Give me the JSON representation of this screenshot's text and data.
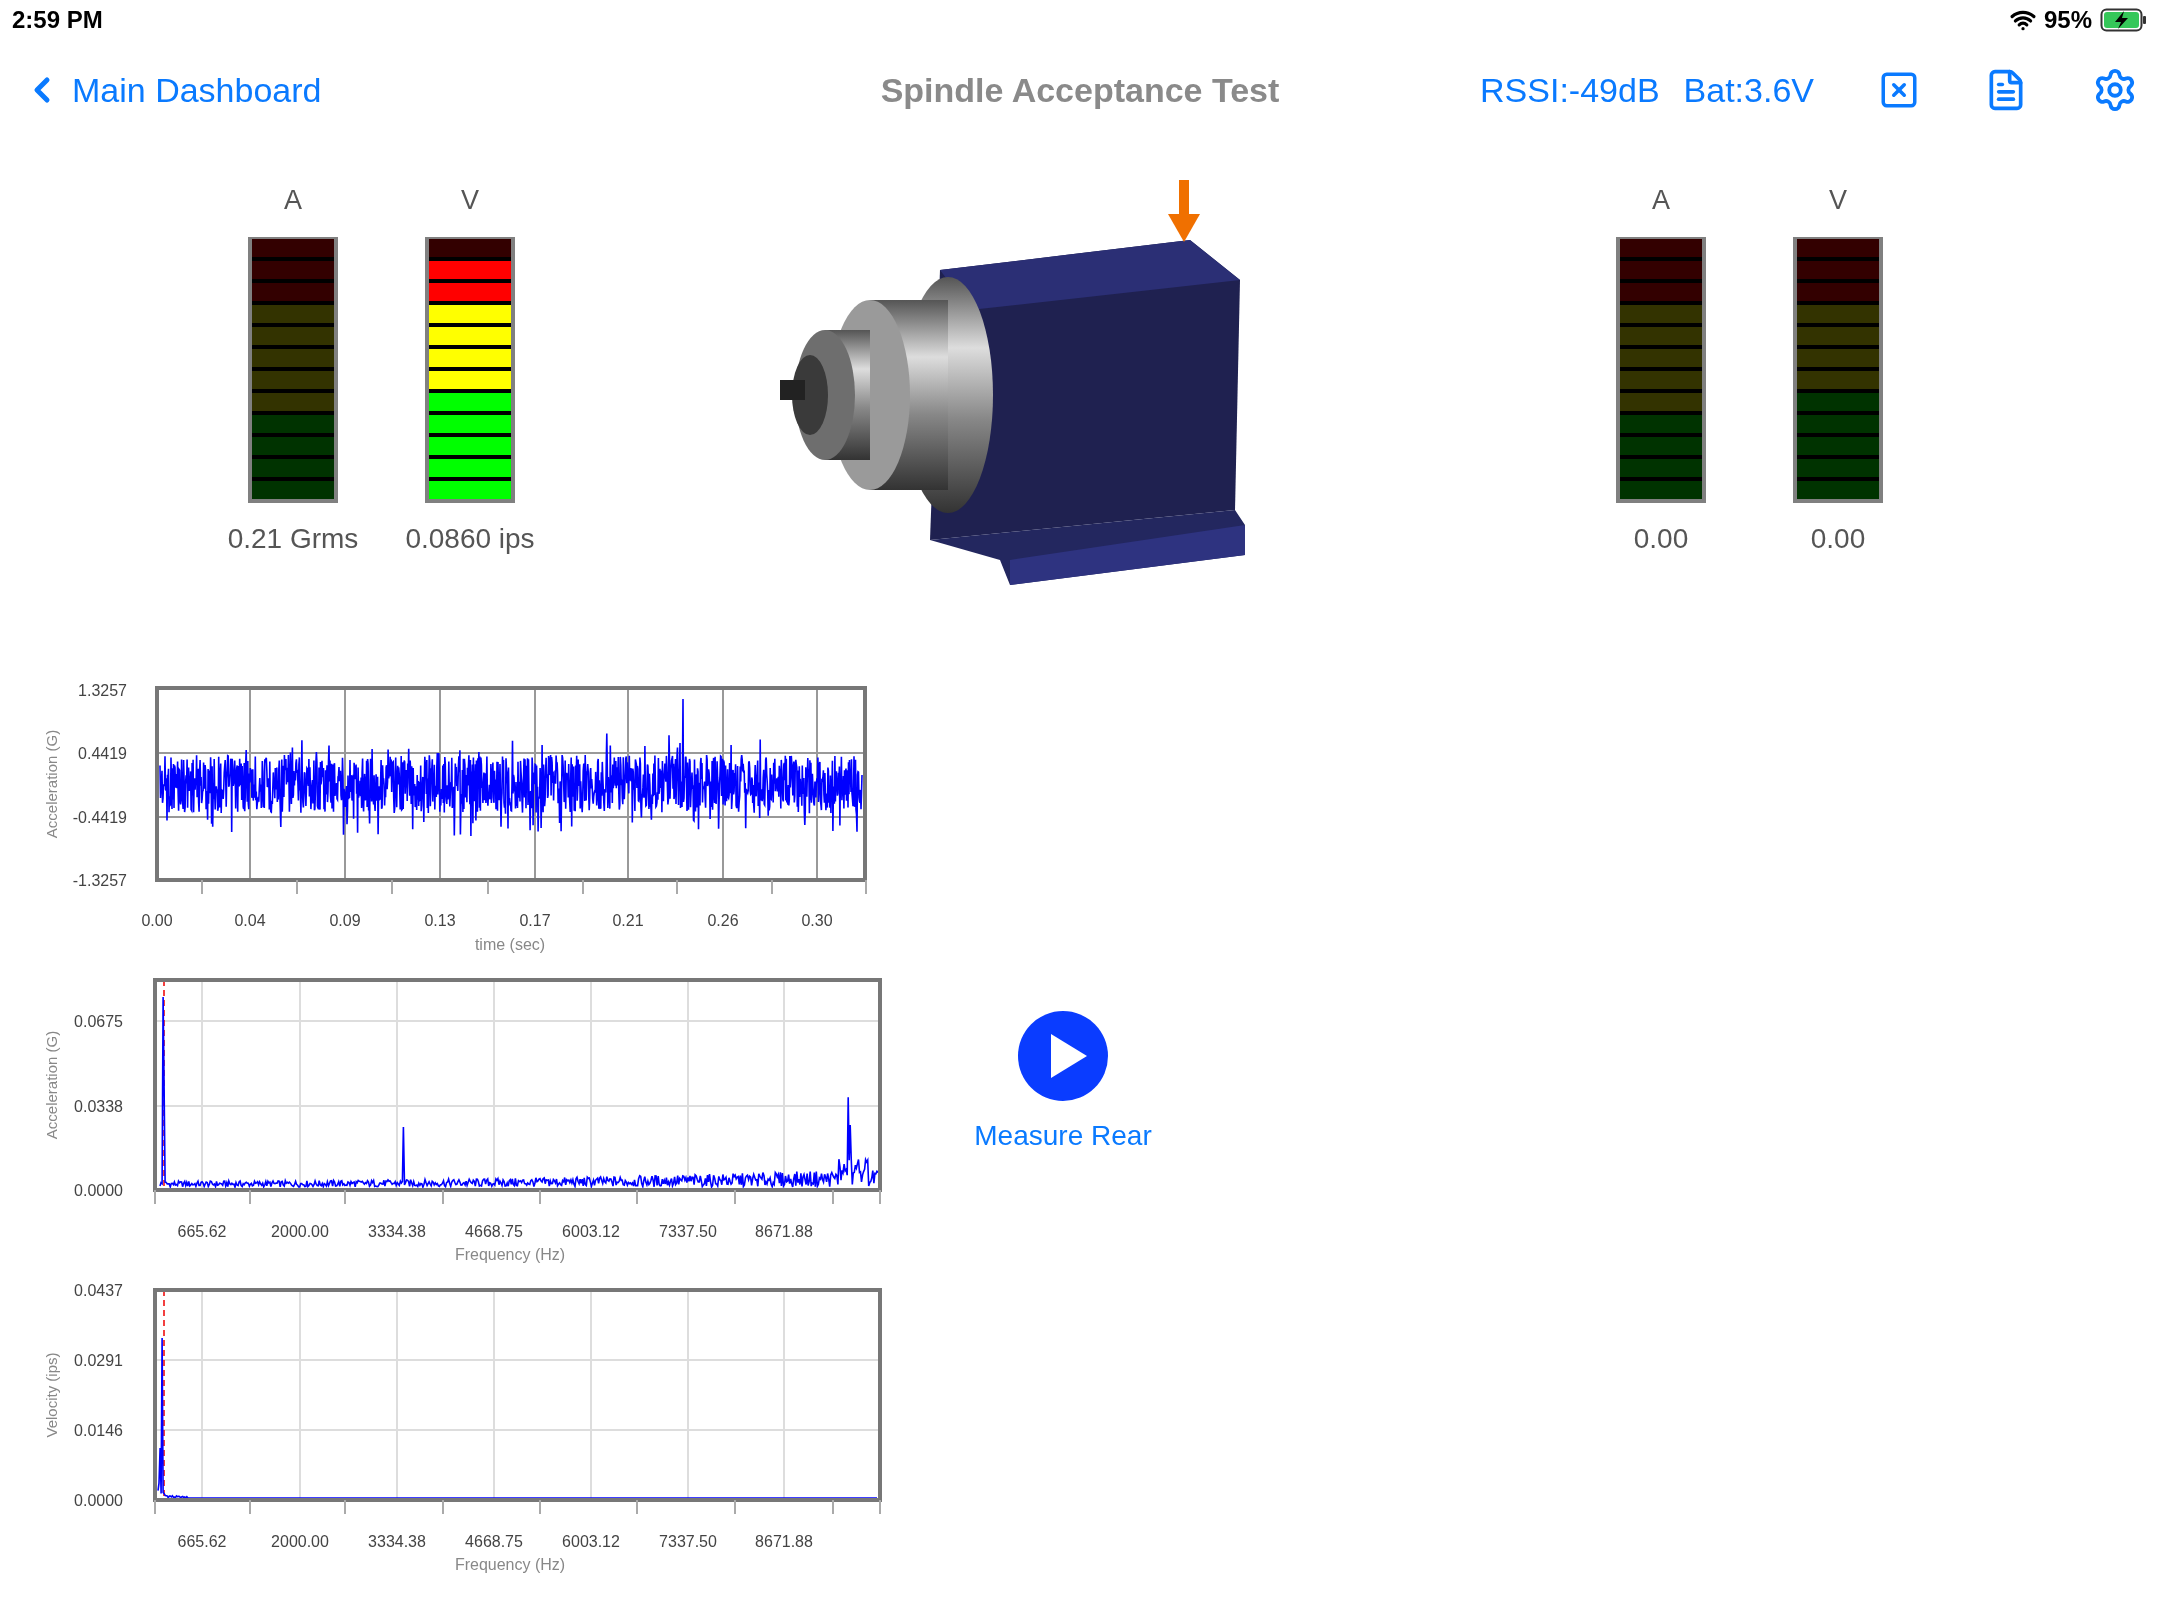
{
  "status_bar": {
    "time": "2:59 PM",
    "battery": "95%"
  },
  "nav": {
    "back": "Main Dashboard",
    "title": "Spindle Acceptance Test",
    "rssi": "RSSI:-49dB",
    "bat": "Bat:3.6V"
  },
  "front_meters": [
    {
      "label": "A",
      "kind": "acceleration",
      "segments": [
        {
          "on": false
        },
        {
          "on": false
        },
        {
          "on": false
        },
        {
          "on": false
        },
        {
          "on": false
        },
        {
          "on": false
        },
        {
          "on": false
        },
        {
          "on": false
        },
        {
          "on": false
        },
        {
          "on": false
        },
        {
          "on": false
        },
        {
          "on": false
        }
      ],
      "reading": "0.21 Grms"
    },
    {
      "label": "V",
      "kind": "velocity",
      "segments": [
        {
          "on": false
        },
        {
          "on": true
        },
        {
          "on": true
        },
        {
          "on": true
        },
        {
          "on": true
        },
        {
          "on": true
        },
        {
          "on": true
        },
        {
          "on": true
        },
        {
          "on": true
        },
        {
          "on": true
        },
        {
          "on": true
        },
        {
          "on": true
        }
      ],
      "reading": "0.0860 ips"
    }
  ],
  "rear_meters": [
    {
      "label": "A",
      "kind": "acceleration",
      "segments": [
        {
          "on": false
        },
        {
          "on": false
        },
        {
          "on": false
        },
        {
          "on": false
        },
        {
          "on": false
        },
        {
          "on": false
        },
        {
          "on": false
        },
        {
          "on": false
        },
        {
          "on": false
        },
        {
          "on": false
        },
        {
          "on": false
        },
        {
          "on": false
        }
      ],
      "reading": "0.00"
    },
    {
      "label": "V",
      "kind": "velocity",
      "segments": [
        {
          "on": false
        },
        {
          "on": false
        },
        {
          "on": false
        },
        {
          "on": false
        },
        {
          "on": false
        },
        {
          "on": false
        },
        {
          "on": false
        },
        {
          "on": false
        },
        {
          "on": false
        },
        {
          "on": false
        },
        {
          "on": false
        },
        {
          "on": false
        }
      ],
      "reading": "0.00"
    }
  ],
  "charts": [
    {
      "kind": "waveform",
      "ylabel": "Acceleration (G)",
      "xlabel": "time (sec)",
      "yticks": [
        "1.3257",
        "0.4419",
        "-0.4419",
        "-1.3257"
      ],
      "xticks": [
        "0.00",
        "0.04",
        "0.09",
        "0.13",
        "0.17",
        "0.21",
        "0.26",
        "0.30"
      ]
    },
    {
      "kind": "accel_spectrum",
      "ylabel": "Acceleration (G)",
      "xlabel": "Frequency (Hz)",
      "yticks": [
        "0.0675",
        "0.0338",
        "0.0000"
      ],
      "xticks": [
        "665.62",
        "2000.00",
        "3334.38",
        "4668.75",
        "6003.12",
        "7337.50",
        "8671.88"
      ]
    },
    {
      "kind": "velocity_spectrum",
      "ylabel": "Velocity (ips)",
      "xlabel": "Frequency (Hz)",
      "yticks": [
        "0.0437",
        "0.0291",
        "0.0146",
        "0.0000"
      ],
      "xticks": [
        "665.62",
        "2000.00",
        "3334.38",
        "4668.75",
        "6003.12",
        "7337.50",
        "8671.88"
      ]
    }
  ],
  "measure_button": "Measure Rear"
}
